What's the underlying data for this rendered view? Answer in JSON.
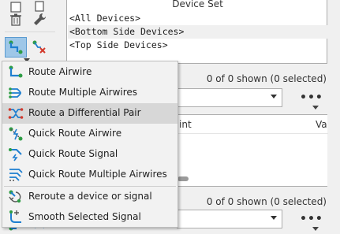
{
  "device_set": {
    "title": "Device Set",
    "items": [
      "<All Devices>",
      "<Bottom Side Devices>",
      "<Top Side Devices>"
    ],
    "selected_index": 1
  },
  "signals": {
    "shown_count": "0 of 0 shown (0 selected)",
    "more_label": "•••",
    "columns": [
      "int",
      "Va"
    ]
  },
  "lower": {
    "shown_count": "0 of 0 shown (0 selected)",
    "more_label": "•••"
  },
  "toolbar": {
    "icons": [
      "box-icon",
      "copy-icon",
      "trash-icon",
      "wrench-icon",
      "route-tool-icon",
      "unroute-icon",
      "route-signal-icon",
      "add-icon"
    ]
  },
  "route_menu": {
    "items": [
      {
        "label": "Route Airwire",
        "icon": "route-airwire-icon"
      },
      {
        "label": "Route Multiple Airwires",
        "icon": "route-multiple-airwires-icon"
      },
      {
        "label": "Route a Differential Pair",
        "icon": "route-differential-pair-icon"
      },
      {
        "label": "Quick Route Airwire",
        "icon": "quick-route-airwire-icon"
      },
      {
        "label": "Quick Route Signal",
        "icon": "quick-route-signal-icon"
      },
      {
        "label": "Quick Route Multiple Airwires",
        "icon": "quick-route-multiple-airwires-icon"
      },
      {
        "label": "Reroute a device or signal",
        "icon": "reroute-icon"
      },
      {
        "label": "Smooth Selected Signal",
        "icon": "smooth-signal-icon"
      }
    ],
    "hovered_index": 2
  },
  "colors": {
    "accent": "#1e7fd0",
    "green": "#2e9d45",
    "red": "#d33a2c",
    "active_button": "#9ec7e8"
  }
}
